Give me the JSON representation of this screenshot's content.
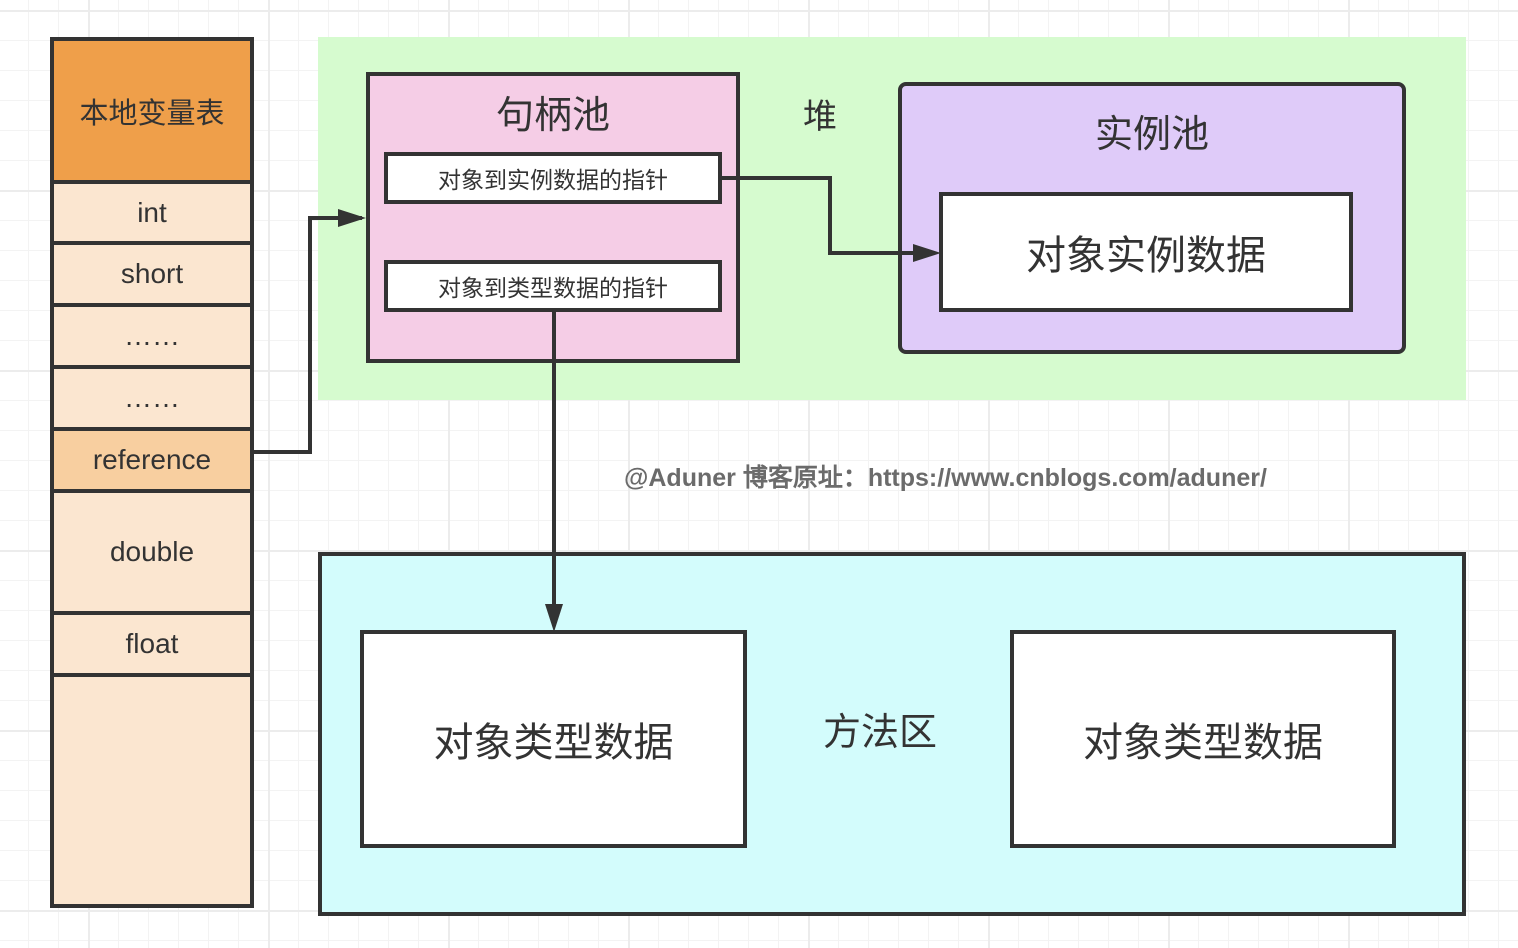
{
  "local_variable_table": {
    "title": "本地变量表",
    "rows": [
      {
        "label": "int",
        "kind": "normal"
      },
      {
        "label": "short",
        "kind": "normal"
      },
      {
        "label": "……",
        "kind": "normal"
      },
      {
        "label": "……",
        "kind": "normal"
      },
      {
        "label": "reference",
        "kind": "reference"
      },
      {
        "label": "double",
        "kind": "normal"
      },
      {
        "label": "float",
        "kind": "normal"
      },
      {
        "label": "",
        "kind": "normal"
      }
    ]
  },
  "heap": {
    "label": "堆",
    "handle_pool": {
      "title": "句柄池",
      "pointer_to_instance": "对象到实例数据的指针",
      "pointer_to_type": "对象到类型数据的指针"
    },
    "instance_pool": {
      "title": "实例池",
      "instance_data": "对象实例数据"
    }
  },
  "method_area": {
    "label": "方法区",
    "type_data_left": "对象类型数据",
    "type_data_right": "对象类型数据"
  },
  "watermark": "@Aduner 博客原址：https://www.cnblogs.com/aduner/",
  "colors": {
    "table_header": "#ef9f4a",
    "table_row": "#fbe6d0",
    "table_reference_row": "#f8cfa0",
    "heap_bg": "#d6fbcf",
    "handle_pool_bg": "#f5cde6",
    "instance_pool_bg": "#dfcbf9",
    "method_area_bg": "#d3fcfc",
    "stroke": "#333333"
  }
}
